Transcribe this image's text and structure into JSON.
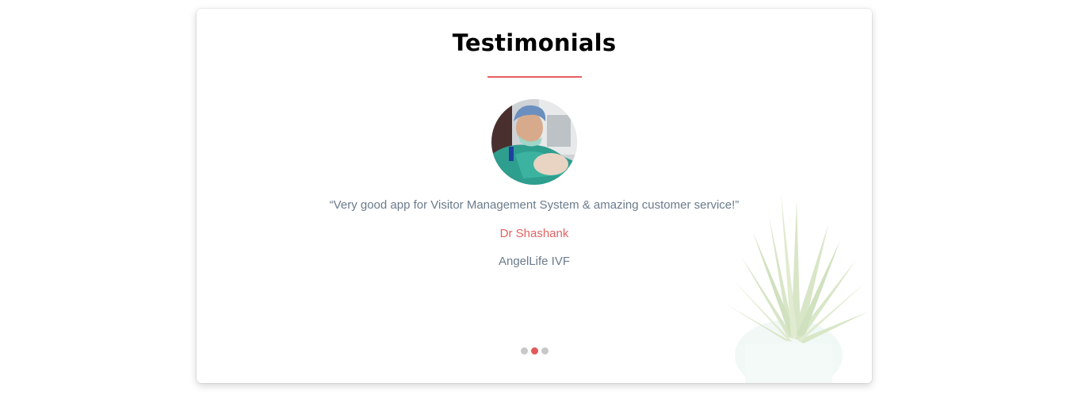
{
  "testimonials": {
    "title": "Testimonials",
    "quote": "“Very good app for Visitor Management System & amazing customer service!”",
    "author_name": "Dr Shashank",
    "author_company": "AngelLife IVF",
    "pagination": {
      "total": 3,
      "active_index": 1
    }
  },
  "colors": {
    "accent": "#e26363",
    "text_muted": "#6b7b8c",
    "dot_inactive": "#c8c8c8"
  },
  "icons": {
    "avatar": "doctor-holding-newborn-photo",
    "decor": "potted-plant-illustration"
  }
}
